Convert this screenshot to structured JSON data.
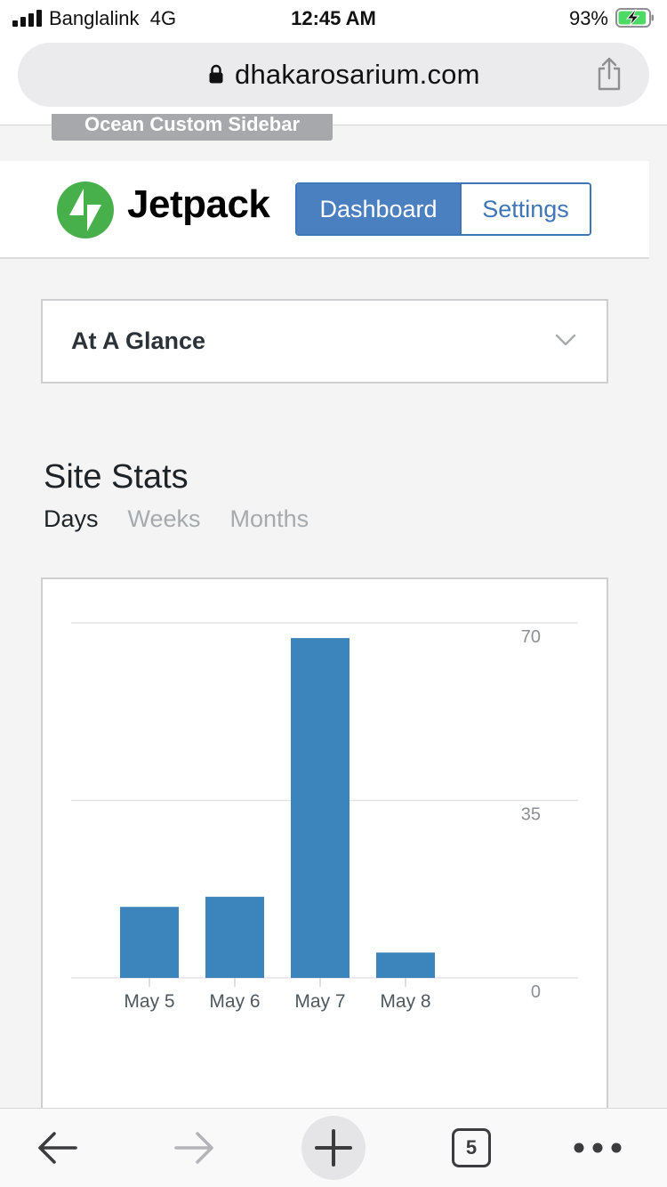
{
  "status_bar": {
    "carrier": "Banglalink",
    "network": "4G",
    "time": "12:45 AM",
    "battery_percent": "93%",
    "battery_level": 0.93,
    "signal_bars": 4
  },
  "browser": {
    "url": "dhakarosarium.com",
    "tabs_count": "5"
  },
  "page": {
    "sidebar_label": "Ocean Custom Sidebar",
    "brand": "Jetpack",
    "nav": {
      "dashboard": "Dashboard",
      "settings": "Settings"
    },
    "glance": {
      "label": "At A Glance"
    },
    "stats": {
      "title": "Site Stats",
      "periods": [
        "Days",
        "Weeks",
        "Months"
      ],
      "active_period": "Days"
    }
  },
  "colors": {
    "accent": "#4a7fc0",
    "bar": "#3c84bc",
    "jetpack_green": "#47b04b",
    "battery_green": "#4cd964"
  },
  "icons": {
    "lock": "lock-icon",
    "share": "share-icon",
    "chevron": "chevron-down-icon",
    "back": "back-arrow-icon",
    "forward": "forward-arrow-icon",
    "new_tab": "plus-icon",
    "tabs": "tabs-icon",
    "more": "more-dots-icon"
  },
  "chart_data": {
    "type": "bar",
    "categories": [
      "May 5",
      "May 6",
      "May 7",
      "May 8"
    ],
    "values": [
      14,
      16,
      67,
      5
    ],
    "ylim": [
      0,
      70
    ],
    "yticks": [
      0,
      35,
      70
    ],
    "grid": true
  }
}
